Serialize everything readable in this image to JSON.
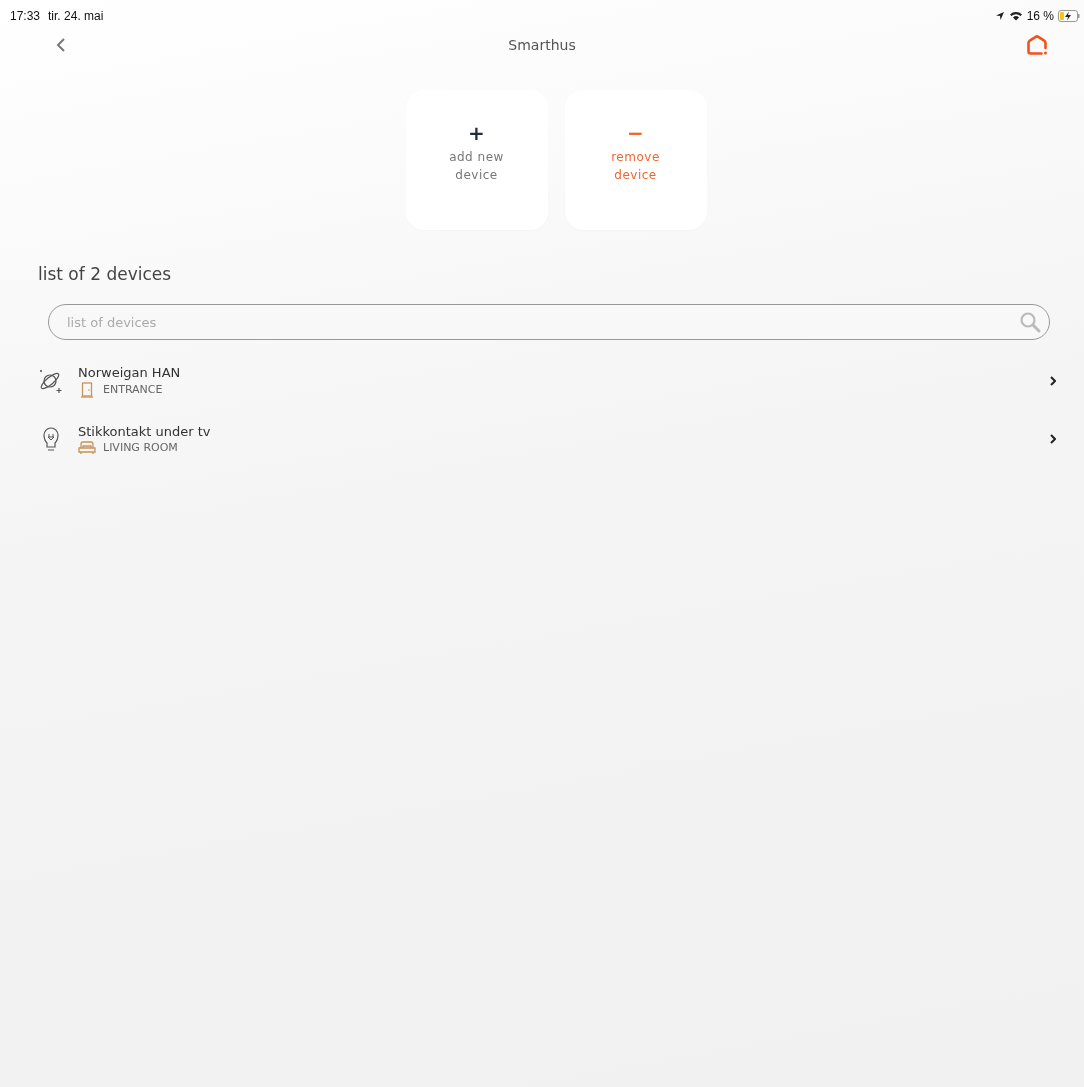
{
  "status_bar": {
    "time": "17:33",
    "date": "tir. 24. mai",
    "battery": "16 %"
  },
  "nav": {
    "title": "Smarthus"
  },
  "actions": [
    {
      "kind": "add",
      "symbol": "+",
      "label": "add new device"
    },
    {
      "kind": "remove",
      "symbol": "−",
      "label": "remove device"
    }
  ],
  "list_title": "list of 2 devices",
  "search": {
    "placeholder": "list of devices"
  },
  "devices": [
    {
      "kind": "meter",
      "name": "Norweigan HAN",
      "room": {
        "kind": "door",
        "label": "ENTRANCE"
      }
    },
    {
      "kind": "plug",
      "name": "Stikkontakt under tv",
      "room": {
        "kind": "sofa",
        "label": "LIVING ROOM"
      }
    }
  ]
}
